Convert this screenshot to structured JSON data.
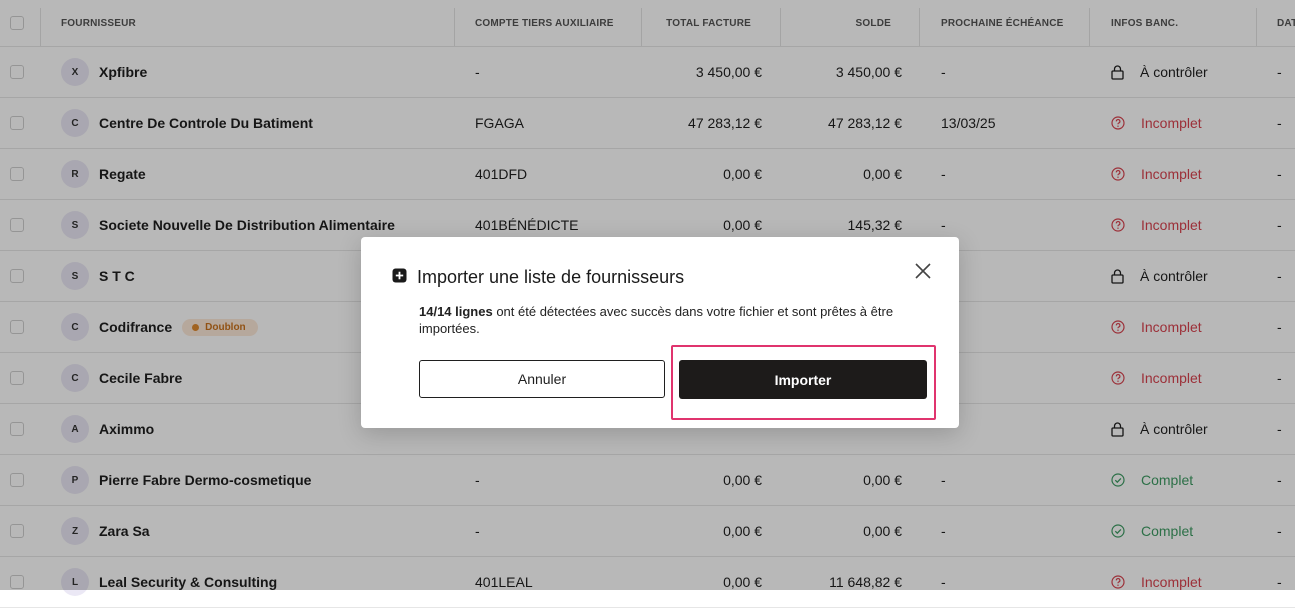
{
  "table": {
    "headers": {
      "fournisseur": "FOURNISSEUR",
      "compte_tiers": "COMPTE TIERS AUXILIAIRE",
      "total_facture": "TOTAL FACTURE",
      "solde": "SOLDE",
      "prochaine_echeance": "PROCHAINE ÉCHÉANCE",
      "infos_banc": "INFOS BANC.",
      "dat": "DAT"
    },
    "rows": [
      {
        "initial": "X",
        "name": "Xpfibre",
        "badge": "",
        "tiers": "-",
        "total": "3 450,00 €",
        "solde": "3 450,00 €",
        "echeance": "-",
        "banc_status": "controler",
        "banc": "À contrôler",
        "dat": "-"
      },
      {
        "initial": "C",
        "name": "Centre De Controle Du Batiment",
        "badge": "",
        "tiers": "FGAGA",
        "total": "47 283,12 €",
        "solde": "47 283,12 €",
        "echeance": "13/03/25",
        "banc_status": "incomplet",
        "banc": "Incomplet",
        "dat": "-"
      },
      {
        "initial": "R",
        "name": "Regate",
        "badge": "",
        "tiers": "401DFD",
        "total": "0,00 €",
        "solde": "0,00 €",
        "echeance": "-",
        "banc_status": "incomplet",
        "banc": "Incomplet",
        "dat": "-"
      },
      {
        "initial": "S",
        "name": "Societe Nouvelle De Distribution Alimentaire",
        "badge": "",
        "tiers": "401BÉNÉDICTE",
        "total": "0,00 €",
        "solde": "145,32 €",
        "echeance": "-",
        "banc_status": "incomplet",
        "banc": "Incomplet",
        "dat": "-"
      },
      {
        "initial": "S",
        "name": "S T C",
        "badge": "",
        "tiers": "",
        "total": "",
        "solde": "",
        "echeance": "",
        "banc_status": "controler",
        "banc": "À contrôler",
        "dat": "-"
      },
      {
        "initial": "C",
        "name": "Codifrance",
        "badge": "Doublon",
        "tiers": "",
        "total": "",
        "solde": "",
        "echeance": "",
        "banc_status": "incomplet",
        "banc": "Incomplet",
        "dat": "-"
      },
      {
        "initial": "C",
        "name": "Cecile Fabre",
        "badge": "",
        "tiers": "",
        "total": "",
        "solde": "",
        "echeance": "",
        "banc_status": "incomplet",
        "banc": "Incomplet",
        "dat": "-"
      },
      {
        "initial": "A",
        "name": "Aximmo",
        "badge": "",
        "tiers": "",
        "total": "",
        "solde": "",
        "echeance": "",
        "banc_status": "controler",
        "banc": "À contrôler",
        "dat": "-"
      },
      {
        "initial": "P",
        "name": "Pierre Fabre Dermo-cosmetique",
        "badge": "",
        "tiers": "-",
        "total": "0,00 €",
        "solde": "0,00 €",
        "echeance": "-",
        "banc_status": "complet",
        "banc": "Complet",
        "dat": "-"
      },
      {
        "initial": "Z",
        "name": "Zara Sa",
        "badge": "",
        "tiers": "-",
        "total": "0,00 €",
        "solde": "0,00 €",
        "echeance": "-",
        "banc_status": "complet",
        "banc": "Complet",
        "dat": "-"
      },
      {
        "initial": "L",
        "name": "Leal Security & Consulting",
        "badge": "",
        "tiers": "401LEAL",
        "total": "0,00 €",
        "solde": "11 648,82 €",
        "echeance": "-",
        "banc_status": "incomplet",
        "banc": "Incomplet",
        "dat": "-"
      }
    ]
  },
  "modal": {
    "title": "Importer une liste de fournisseurs",
    "message_bold": "14/14 lignes",
    "message_rest": " ont été détectées avec succès dans votre fichier et sont prêtes à être importées.",
    "cancel_label": "Annuler",
    "import_label": "Importer",
    "title_icon": "plus-square-icon",
    "close_icon": "close-icon"
  },
  "colors": {
    "incomplet": "#d9434f",
    "complet": "#3e9b63",
    "badge": "#e08a2e",
    "primary_button": "#1d1b1a",
    "highlight": "#e0346e"
  }
}
